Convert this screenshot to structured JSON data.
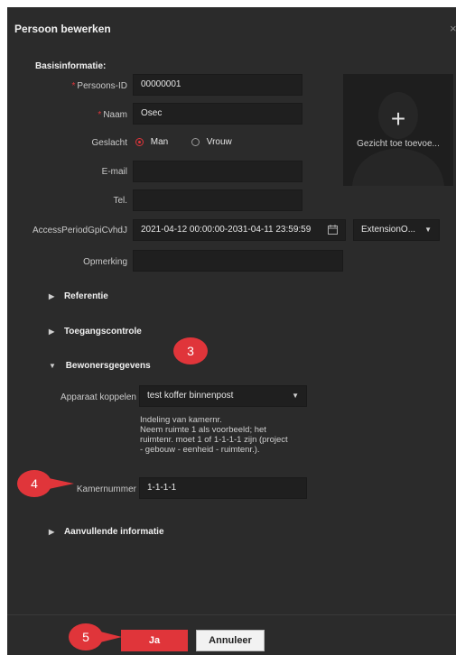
{
  "dialog": {
    "title": "Persoon bewerken",
    "close_symbol": "×"
  },
  "basic": {
    "heading": "Basisinformatie:",
    "person_id_label": "Persoons-ID",
    "person_id_value": "00000001",
    "name_label": "Naam",
    "name_value": "Osec",
    "gender_label": "Geslacht",
    "gender_male": "Man",
    "gender_female": "Vrouw",
    "email_label": "E-mail",
    "email_value": "",
    "phone_label": "Tel.",
    "phone_value": "",
    "access_label": "AccessPeriodGpiCvhdJ",
    "access_value": "2021-04-12 00:00:00-2031-04-11 23:59:59",
    "extension_value": "ExtensionO...",
    "remark_label": "Opmerking",
    "remark_value": "",
    "photo_label": "Gezicht toe toevoe..."
  },
  "sections": {
    "reference": "Referentie",
    "access_control": "Toegangscontrole",
    "residents": "Bewonersgegevens",
    "additional": "Aanvullende informatie"
  },
  "residents": {
    "device_label": "Apparaat koppelen",
    "device_value": "test koffer binnenpost",
    "hint_line1": "Indeling van kamernr.",
    "hint_line2": "Neem ruimte 1 als voorbeeld; het",
    "hint_line3": "ruimtenr. moet 1 of 1-1-1-1 zijn (project",
    "hint_line4": "- gebouw - eenheid - ruimtenr.).",
    "room_label": "Kamernummer",
    "room_value": "1-1-1-1"
  },
  "badges": {
    "b3": "3",
    "b4": "4",
    "b5": "5"
  },
  "footer": {
    "ok_label": "Ja",
    "cancel_label": "Annuleer"
  },
  "colors": {
    "accent": "#e0353a",
    "dialog_bg": "#2b2b2b",
    "field_bg": "#1f1f1f"
  },
  "icons": {
    "calendar": "calendar-icon",
    "plus": "plus-icon",
    "caret": "caret-right-icon",
    "dropdown": "dropdown-arrow-icon"
  }
}
